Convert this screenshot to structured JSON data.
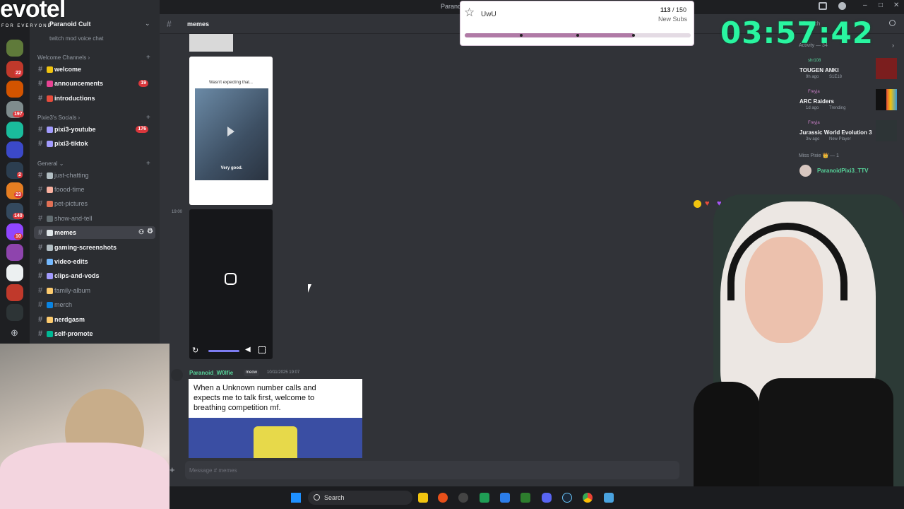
{
  "overlay": {
    "logo": "evotel",
    "logo_tag": "FOR EVERYONE",
    "timer": "03:57:42",
    "subgoal_title": "UwU",
    "subgoal_count": "113",
    "subgoal_total": "/ 150",
    "subgoal_label": "New Subs",
    "subgoal_progress": 0.75
  },
  "server": {
    "name": "Paranoid Cult",
    "voice": "twitch mod voice chat"
  },
  "categories": {
    "welcome": "Welcome Channels",
    "socials": "Pixie3's Socials",
    "general": "General"
  },
  "channels": [
    {
      "name": "welcome"
    },
    {
      "name": "announcements",
      "count": "19"
    },
    {
      "name": "introductions"
    },
    {
      "name": "pixi3-youtube",
      "count": "176"
    },
    {
      "name": "pixi3-tiktok"
    },
    {
      "name": "just-chatting"
    },
    {
      "name": "foood-time"
    },
    {
      "name": "pet-pictures"
    },
    {
      "name": "show-and-tell"
    },
    {
      "name": "memes"
    },
    {
      "name": "gaming-screenshots"
    },
    {
      "name": "video-edits"
    },
    {
      "name": "clips-and-vods"
    },
    {
      "name": "family-album"
    },
    {
      "name": "merch"
    },
    {
      "name": "nerdgasm"
    },
    {
      "name": "self-promote"
    }
  ],
  "rail_badges": [
    "22",
    "197",
    "2",
    "23",
    "140",
    "10"
  ],
  "header": {
    "channel": "memes",
    "window_title": "Parano",
    "search": "Search"
  },
  "messages": {
    "card_caption": "Wasn't expecting that...",
    "card_sub": "Very good.",
    "timestamp": "19:00",
    "author": "Paranoid_W0lfie",
    "role": "meow",
    "date": "10/11/2025 19:07",
    "meme_text": "When a Unknown number calls and expects me to talk first, welcome to breathing competition mf."
  },
  "composer": {
    "placeholder": "Message # memes"
  },
  "activity": {
    "header": "Activity — 34",
    "items": [
      {
        "user": "shr108",
        "title": "TOUGEN ANKI",
        "meta": "9h ago",
        "detail": "S1E18"
      },
      {
        "user": "Freyja",
        "title": "ARC Raiders",
        "meta": "1d ago",
        "detail": "Trending"
      },
      {
        "user": "Freyja",
        "title": "Jurassic World Evolution 3",
        "meta": "3w ago",
        "detail": "New Player"
      }
    ],
    "role_header": "Miss Pixie 👑 — 1",
    "member": "ParanoidPixi3_TTV"
  },
  "taskbar": {
    "search": "Search"
  },
  "colors": {
    "accent": "#5865f2",
    "timer": "#29f5a0",
    "progress": "#b07aa6"
  }
}
